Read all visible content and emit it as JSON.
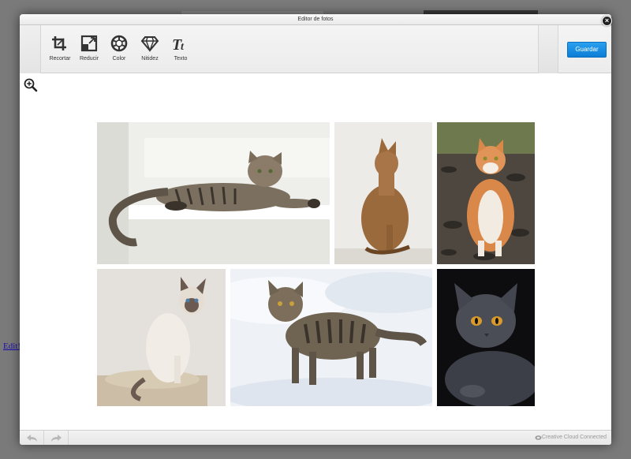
{
  "window": {
    "title": "Editor de fotos",
    "close_label": "×"
  },
  "background": {
    "edit_link": "Edit!"
  },
  "toolbar": {
    "tools": [
      {
        "label": "Recortar",
        "icon": "crop-icon"
      },
      {
        "label": "Reducir",
        "icon": "resize-icon"
      },
      {
        "label": "Color",
        "icon": "color-icon"
      },
      {
        "label": "Nitidez",
        "icon": "sharpness-icon"
      },
      {
        "label": "Texto",
        "icon": "text-icon"
      }
    ],
    "save_label": "Guardar"
  },
  "canvas": {
    "zoom_icon": "zoom-in-icon",
    "photos": [
      {
        "subject": "tabby cat lying on white steps"
      },
      {
        "subject": "abyssinian cat sitting"
      },
      {
        "subject": "orange and white cat on rocks"
      },
      {
        "subject": "siamese cat sitting"
      },
      {
        "subject": "tabby cat walking in snow"
      },
      {
        "subject": "grey cat on black background"
      }
    ]
  },
  "footer": {
    "undo_icon": "undo-icon",
    "redo_icon": "redo-icon",
    "status_text": "Creative Cloud Connected"
  },
  "colors": {
    "accent": "#0b7dd6",
    "overlay": "#7a7a7a"
  }
}
